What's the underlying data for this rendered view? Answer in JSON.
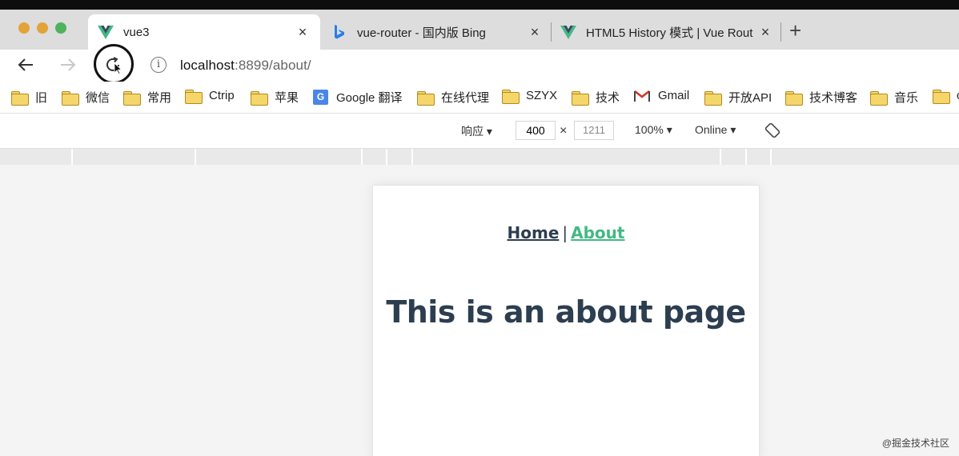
{
  "window": {
    "tabs": [
      {
        "label": "vue3",
        "icon": "vue-logo-icon",
        "active": true
      },
      {
        "label": "vue-router - 国内版 Bing",
        "icon": "bing-logo-icon",
        "active": false
      },
      {
        "label": "HTML5 History 模式 | Vue Rout",
        "icon": "vue-logo-icon",
        "active": false
      }
    ],
    "close_glyph": "×",
    "new_tab_glyph": "+"
  },
  "toolbar": {
    "url_host": "localhost",
    "url_rest": ":8899/about/",
    "info_glyph": "i"
  },
  "bookmarks": [
    {
      "label": "旧",
      "icon": "folder-icon"
    },
    {
      "label": "微信",
      "icon": "folder-icon"
    },
    {
      "label": "常用",
      "icon": "folder-icon"
    },
    {
      "label": "Ctrip",
      "icon": "folder-icon"
    },
    {
      "label": "苹果",
      "icon": "folder-icon"
    },
    {
      "label": "Google 翻译",
      "icon": "google-translate-icon"
    },
    {
      "label": "在线代理",
      "icon": "folder-icon"
    },
    {
      "label": "SZYX",
      "icon": "folder-icon"
    },
    {
      "label": "技术",
      "icon": "folder-icon"
    },
    {
      "label": "Gmail",
      "icon": "gmail-icon"
    },
    {
      "label": "开放API",
      "icon": "folder-icon"
    },
    {
      "label": "技术博客",
      "icon": "folder-icon"
    },
    {
      "label": "音乐",
      "icon": "folder-icon"
    },
    {
      "label": "c",
      "icon": "folder-icon"
    }
  ],
  "device_toolbar": {
    "mode": "响应 ▾",
    "width": "400",
    "times": "×",
    "height": "1211",
    "zoom": "100% ▾",
    "throttle": "Online ▾"
  },
  "page": {
    "nav_home": "Home",
    "nav_separator": "|",
    "nav_about": "About",
    "heading": "This is an about page"
  },
  "watermark": "@掘金技术社区",
  "colors": {
    "vue_green": "#42b983",
    "vue_dark": "#2c3e50",
    "traffic_orange": "#e2a337",
    "traffic_green": "#4fb25c"
  }
}
